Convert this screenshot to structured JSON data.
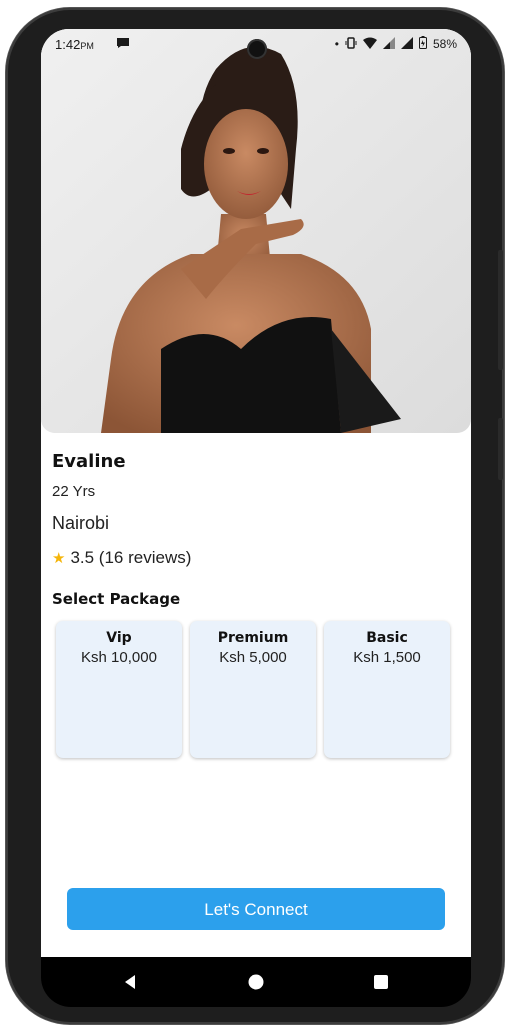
{
  "status_bar": {
    "time": "1:42",
    "ampm": "PM",
    "battery": "58%",
    "icons": [
      "chat-icon",
      "dot-icon",
      "vibrate-icon",
      "wifi-icon",
      "signal-icon",
      "signal-icon",
      "battery-icon"
    ]
  },
  "profile": {
    "photo_icon": "profile-photo",
    "name": "Evaline",
    "age": "22 Yrs",
    "city": "Nairobi",
    "rating": "3.5 (16 reviews)",
    "star_color": "#f5b50a"
  },
  "packages": {
    "title": "Select Package",
    "items": [
      {
        "name": "Vip",
        "price": "Ksh 10,000"
      },
      {
        "name": "Premium",
        "price": "Ksh 5,000"
      },
      {
        "name": "Basic",
        "price": "Ksh 1,500"
      }
    ],
    "card_color": "#eaf2fb"
  },
  "cta": {
    "label": "Let's Connect",
    "color": "#2ca0ec"
  },
  "nav": {
    "icons": [
      "back-icon",
      "home-icon",
      "recents-icon"
    ]
  }
}
